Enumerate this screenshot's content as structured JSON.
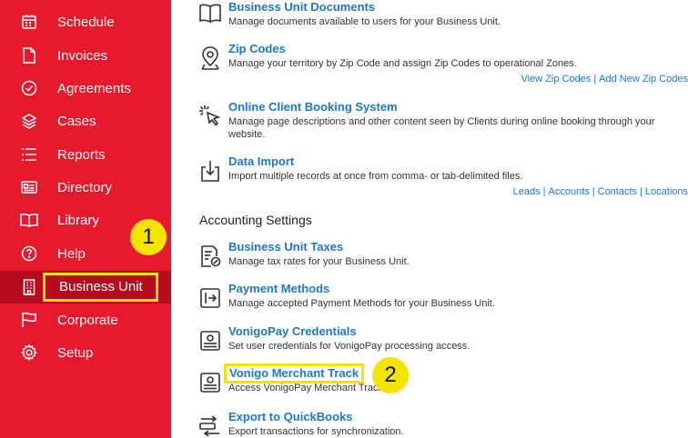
{
  "sidebar": {
    "items": [
      {
        "label": "Schedule",
        "icon": "calendar-icon"
      },
      {
        "label": "Invoices",
        "icon": "document-icon"
      },
      {
        "label": "Agreements",
        "icon": "check-circle-icon"
      },
      {
        "label": "Cases",
        "icon": "layers-icon"
      },
      {
        "label": "Reports",
        "icon": "list-icon"
      },
      {
        "label": "Directory",
        "icon": "id-card-icon"
      },
      {
        "label": "Library",
        "icon": "book-icon"
      },
      {
        "label": "Help",
        "icon": "question-circle-icon"
      },
      {
        "label": "Business Unit",
        "icon": "building-icon",
        "active": true
      },
      {
        "label": "Corporate",
        "icon": "flag-icon"
      },
      {
        "label": "Setup",
        "icon": "gear-icon"
      }
    ]
  },
  "annotations": {
    "badge_1": "1",
    "badge_2": "2"
  },
  "main": {
    "entries": [
      {
        "title": "Business Unit Documents",
        "description": "Manage documents available to users for your Business Unit.",
        "icon": "book-icon"
      },
      {
        "title": "Zip Codes",
        "description": "Manage your territory by Zip Code and assign Zip Codes to operational Zones.",
        "icon": "map-pin-icon",
        "links": [
          "View Zip Codes",
          "Add New Zip Codes"
        ]
      },
      {
        "title": "Online Client Booking System",
        "description": "Manage page descriptions and other content seen by Clients during online booking through your website.",
        "icon": "cursor-click-icon"
      },
      {
        "title": "Data Import",
        "description": "Import multiple records at once from comma- or tab-delimited files.",
        "icon": "import-icon",
        "links": [
          "Leads",
          "Accounts",
          "Contacts",
          "Locations"
        ]
      }
    ],
    "section_title": "Accounting Settings",
    "accounting": [
      {
        "title": "Business Unit Taxes",
        "description": "Manage tax rates for your Business Unit.",
        "icon": "tax-document-icon"
      },
      {
        "title": "Payment Methods",
        "description": "Manage accepted Payment Methods for your Business Unit.",
        "icon": "payment-method-icon"
      },
      {
        "title": "VonigoPay Credentials",
        "description": "Set user credentials for VonigoPay processing access.",
        "icon": "payment-terminal-icon"
      },
      {
        "title": "Vonigo Merchant Track",
        "description": "Access VonigoPay Merchant Track.",
        "icon": "payment-terminal-icon",
        "highlighted": true
      },
      {
        "title": "Export to QuickBooks",
        "description": "Export transactions for synchronization.",
        "icon": "sync-export-icon"
      }
    ]
  },
  "colors": {
    "sidebar": "#e8192c",
    "sidebar_active": "#b50d1e",
    "link": "#1f78c6",
    "highlight": "#f5e400"
  }
}
